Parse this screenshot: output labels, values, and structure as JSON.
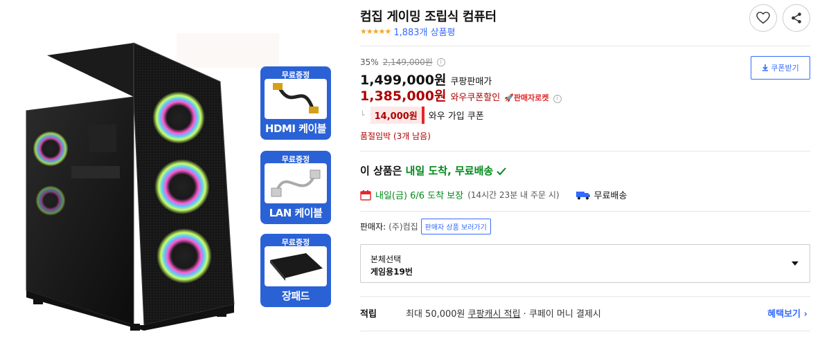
{
  "product": {
    "title": "컴집 게이밍 조립식 컴퓨터",
    "stars": "★★★★★",
    "review_count": "1,883개 상품평"
  },
  "gifts": [
    {
      "badge": "무료증정",
      "name": "HDMI 케이블",
      "icon": "hdmi-cable-icon"
    },
    {
      "badge": "무료증정",
      "name": "LAN 케이블",
      "icon": "lan-cable-icon"
    },
    {
      "badge": "무료증정",
      "name": "장패드",
      "icon": "mousepad-icon"
    }
  ],
  "pricing": {
    "discount_rate": "35%",
    "original_price": "2,149,000원",
    "coupang_price": "1,499,000원",
    "coupang_label": "쿠팡판매가",
    "wow_price": "1,385,000원",
    "wow_label": "와우쿠폰할인",
    "seller_rocket": "판매자로켓",
    "coupon_amount": "14,000원",
    "coupon_desc": "와우 가입 쿠폰",
    "coupon_button": "쿠폰받기"
  },
  "stock_notice": "품절임박 (3개 남음)",
  "delivery": {
    "headline_prefix": "이 상품은 ",
    "headline_green": "내일 도착, 무료배송",
    "date_text": "내일(금) 6/6 도착 보장",
    "deadline": "(14시간 23분 내 주문 시)",
    "shipping": "무료배송"
  },
  "seller": {
    "label": "판매자:",
    "name": "(주)컴집",
    "button": "판매자 상품 보러가기"
  },
  "option": {
    "label": "본체선택",
    "value": "게임용19번"
  },
  "points": {
    "label": "적립",
    "prefix": "최대 50,000원 ",
    "link": "쿠팡캐시 적립",
    "suffix": " · 쿠페이 머니 결제시",
    "benefit": "혜택보기"
  },
  "colors": {
    "accent_blue": "#346aff",
    "wow_red": "#ae0000",
    "delivery_green": "#00891a",
    "gift_blue": "#2a62d6"
  }
}
